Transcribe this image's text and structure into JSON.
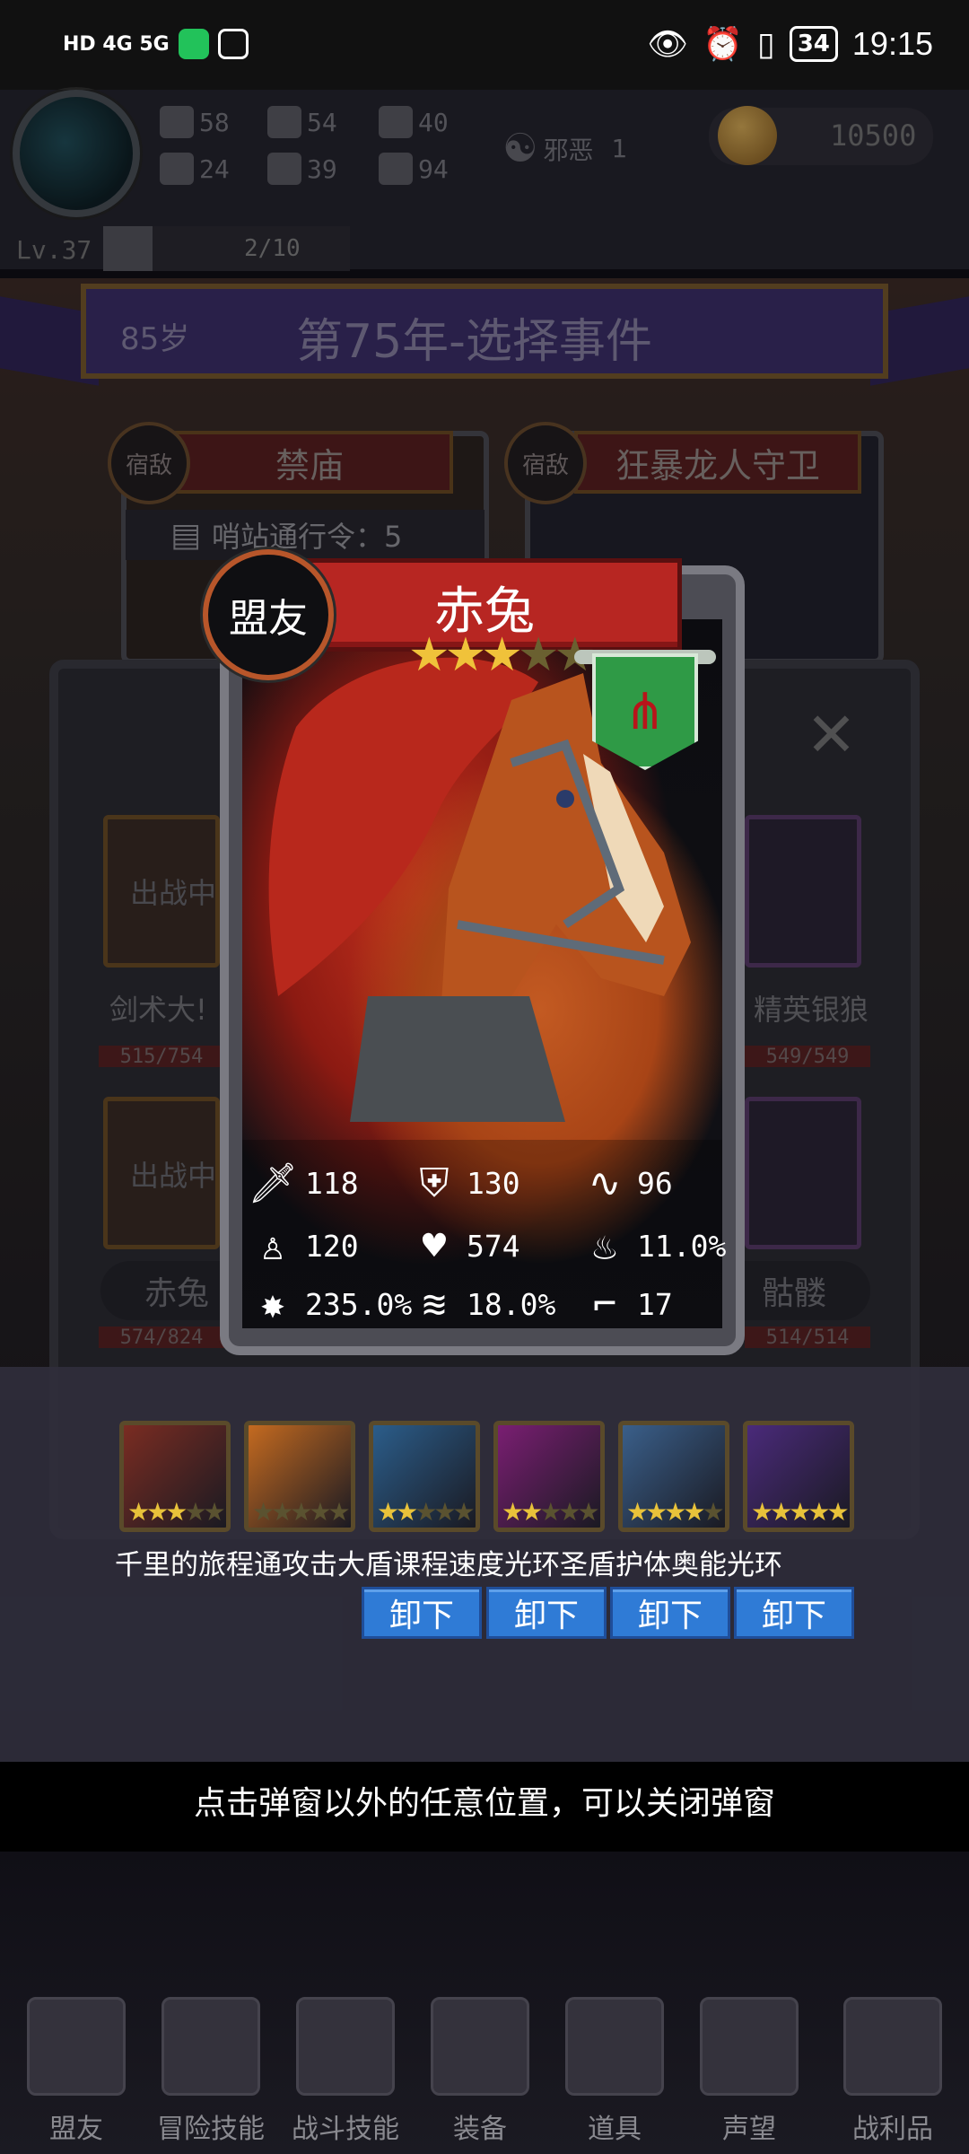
{
  "status_bar": {
    "network": "HD 4G 5G",
    "battery": "34",
    "time": "19:15"
  },
  "hud": {
    "stats": [
      {
        "icon": "fist-icon",
        "value": "58"
      },
      {
        "icon": "arrow-icon",
        "value": "54"
      },
      {
        "icon": "wizard-hat-icon",
        "value": "40"
      },
      {
        "icon": "clover-icon",
        "value": "24"
      },
      {
        "icon": "scroll-icon",
        "value": "39"
      },
      {
        "icon": "lotus-icon",
        "value": "94"
      }
    ],
    "alignment_label": "邪恶",
    "alignment_value": "1",
    "gold": "10500",
    "level": "Lv.37",
    "xp_text": "2/10",
    "xp_fraction": 0.2
  },
  "event": {
    "age": "85岁",
    "title": "第75年-选择事件",
    "cards": [
      {
        "badge": "宿敌",
        "name": "禁庙"
      },
      {
        "badge": "宿敌",
        "name": "狂暴龙人守卫"
      }
    ],
    "pass": "哨站通行令：5"
  },
  "party": {
    "slots": [
      {
        "status": "出战中",
        "name": "剑术大!",
        "hp": "515/754"
      },
      {
        "status": "",
        "name": "精英银狼",
        "hp": "549/549"
      },
      {
        "status": "出战中",
        "name": "赤兔",
        "hp": "574/824"
      },
      {
        "status": "",
        "name": "骷髅",
        "hp": "514/514"
      }
    ]
  },
  "card": {
    "badge": "盟友",
    "name": "赤兔",
    "stars": 3,
    "max_stars": 5,
    "type_icon": "claw-icon",
    "stats": [
      {
        "icon": "sword-icon",
        "value": "118"
      },
      {
        "icon": "shield-icon",
        "value": "130"
      },
      {
        "icon": "whip-icon",
        "value": "96"
      },
      {
        "icon": "hood-icon",
        "value": "120"
      },
      {
        "icon": "heart-icon",
        "value": "574"
      },
      {
        "icon": "flame-icon",
        "value": "11.0%"
      },
      {
        "icon": "burst-icon",
        "value": "235.0%"
      },
      {
        "icon": "tornado-icon",
        "value": "18.0%"
      },
      {
        "icon": "boot-icon",
        "value": "17"
      }
    ]
  },
  "skills": [
    {
      "name": "千里的旅程",
      "stars": 3,
      "color": "#7a2c22"
    },
    {
      "name": "通攻击",
      "stars": 0,
      "color": "#c46a20"
    },
    {
      "name": "大盾课程",
      "stars": 2,
      "color": "#2b5d8a"
    },
    {
      "name": "速度光环",
      "stars": 2,
      "color": "#7a1e72"
    },
    {
      "name": "圣盾护体",
      "stars": 4,
      "color": "#3a5f8a"
    },
    {
      "name": "奥能光环",
      "stars": 5,
      "color": "#4a2a7a"
    }
  ],
  "unequip_label": "卸下",
  "hint": "点击弹窗以外的任意位置，可以关闭弹窗",
  "nav": [
    {
      "label": "盟友",
      "icon": "handshake-icon"
    },
    {
      "label": "冒险技能",
      "icon": "book-icon"
    },
    {
      "label": "战斗技能",
      "icon": "backpack-icon"
    },
    {
      "label": "装备",
      "icon": "crossed-swords-icon"
    },
    {
      "label": "道具",
      "icon": "satchel-icon"
    },
    {
      "label": "声望",
      "icon": "scroll-icon"
    },
    {
      "label": "战利品",
      "icon": "chest-icon"
    }
  ]
}
